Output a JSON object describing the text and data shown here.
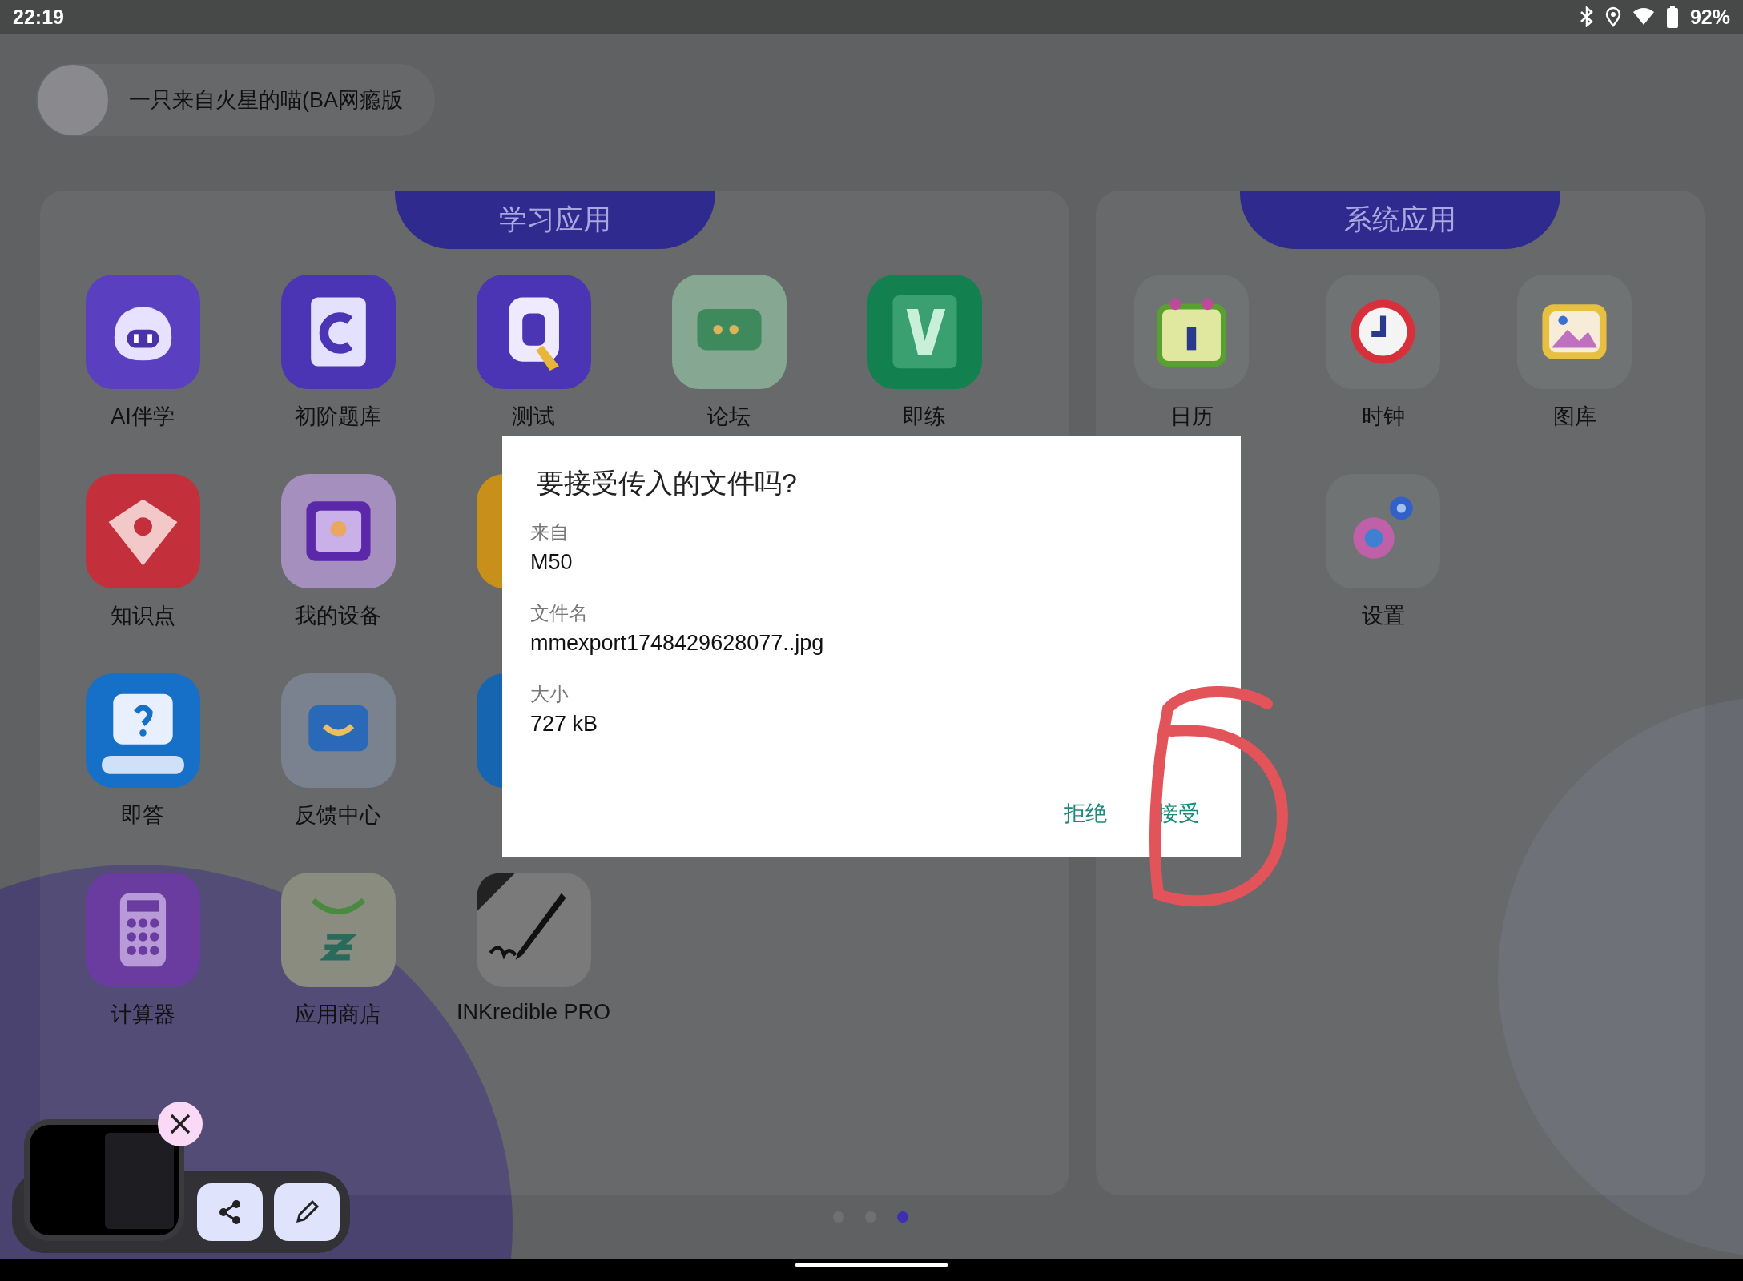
{
  "status_bar": {
    "time": "22:19",
    "battery": "92%"
  },
  "profile": {
    "name": "一只来自火星的喵(BA网瘾版"
  },
  "panels": [
    {
      "title": "学习应用",
      "apps": [
        {
          "label": "AI伴学",
          "kind": "robot"
        },
        {
          "label": "初阶题库",
          "kind": "letter-book"
        },
        {
          "label": "测试",
          "kind": "quiz"
        },
        {
          "label": "论坛",
          "kind": "chat"
        },
        {
          "label": "即练",
          "kind": "practice"
        },
        {
          "label": "知识点",
          "kind": "gem"
        },
        {
          "label": "我的设备",
          "kind": "device"
        },
        {
          "kind": "yellow-tile"
        },
        {
          "kind": "empty"
        },
        {
          "kind": "empty"
        },
        {
          "label": "即答",
          "kind": "question"
        },
        {
          "label": "反馈中心",
          "kind": "feedback"
        },
        {
          "kind": "blue-tile"
        },
        {
          "kind": "empty"
        },
        {
          "kind": "empty"
        },
        {
          "label": "计算器",
          "kind": "calculator"
        },
        {
          "label": "应用商店",
          "kind": "store"
        },
        {
          "label": "INKredible PRO",
          "kind": "pen"
        }
      ]
    },
    {
      "title": "系统应用",
      "apps": [
        {
          "label": "日历",
          "kind": "calendar"
        },
        {
          "label": "时钟",
          "kind": "clock"
        },
        {
          "label": "图库",
          "kind": "gallery"
        },
        {
          "kind": "empty"
        },
        {
          "label": "设置",
          "kind": "settings"
        }
      ]
    }
  ],
  "page_dots": [
    {
      "selected": false
    },
    {
      "selected": false
    },
    {
      "selected": true
    }
  ],
  "dialog": {
    "title": "要接受传入的文件吗?",
    "fields": [
      {
        "label": "来自",
        "value": "M50"
      },
      {
        "label": "文件名",
        "value": "mmexport1748429628077..jpg"
      },
      {
        "label": "大小",
        "value": "727 kB"
      }
    ],
    "buttons": [
      {
        "label": "拒绝"
      },
      {
        "label": "接受"
      }
    ]
  }
}
